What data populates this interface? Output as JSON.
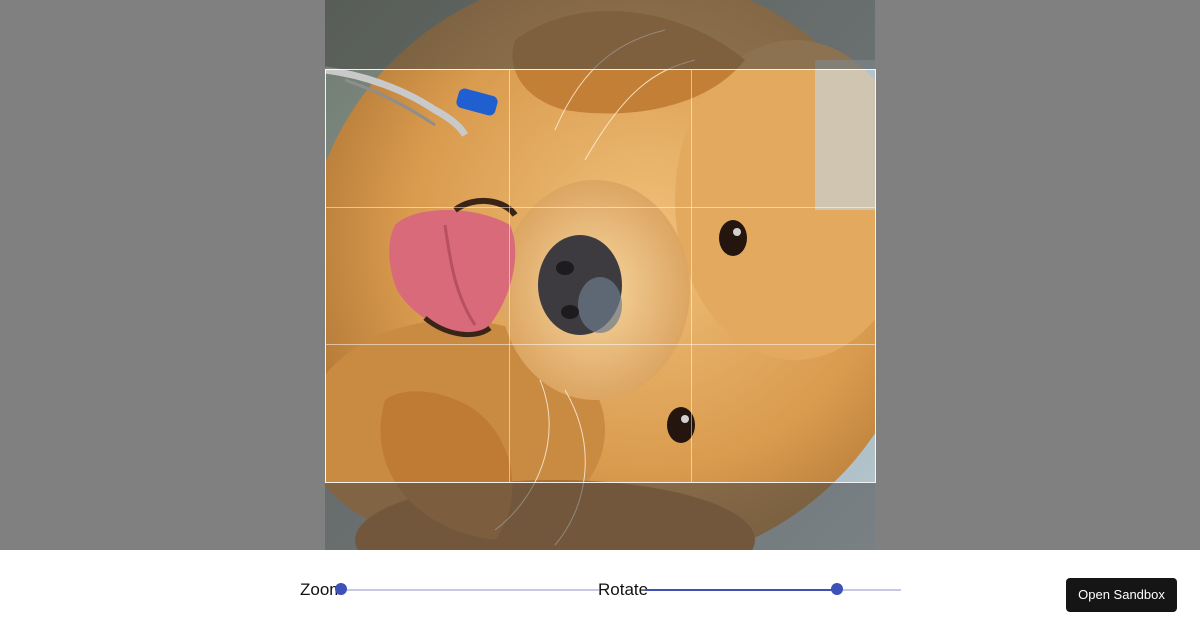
{
  "cropper": {
    "image_subject": "golden retriever puppy (rotated)",
    "grid": "rule-of-thirds"
  },
  "controls": {
    "zoom": {
      "label": "Zoom",
      "value_fraction": 0.0
    },
    "rotate": {
      "label": "Rotate",
      "value_fraction": 0.75
    }
  },
  "actions": {
    "open_sandbox_label": "Open Sandbox"
  },
  "colors": {
    "backdrop": "#808080",
    "accent": "#3f51b5",
    "track": "#c7c9e0",
    "button_bg": "#151515"
  }
}
